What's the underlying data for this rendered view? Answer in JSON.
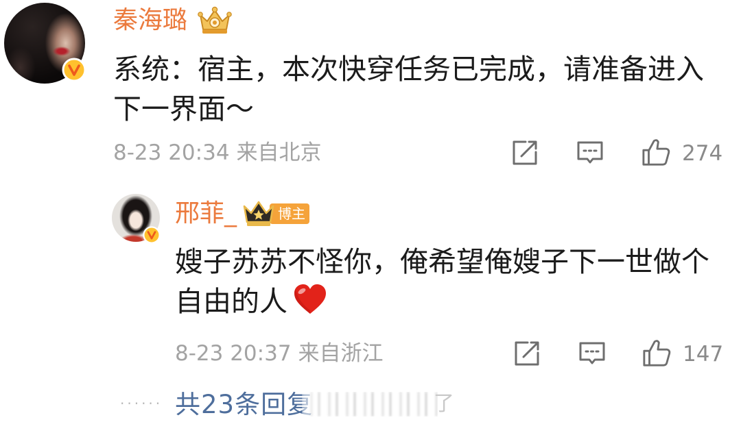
{
  "comment": {
    "username": "秦海璐",
    "verified_icon": "verified-v-icon",
    "member_icon": "gold-crown-icon",
    "lines": [
      "系统：宿主，本次快穿任务已完成，请准备进入",
      "下一界面～"
    ],
    "time": "8-23 20:34",
    "location": "来自北京",
    "likes": "274",
    "replies": [
      {
        "username": "邢菲_",
        "verified_icon": "verified-v-icon",
        "member_icon": "star-crown-icon",
        "badge": "博主",
        "lines": [
          "嫂子苏苏不怪你，俺希望俺嫂子下一世做个",
          "自由的人"
        ],
        "emoji": "red-heart-emoji",
        "time": "8-23 20:37",
        "location": "来自浙江",
        "likes": "147"
      }
    ],
    "more_replies": {
      "dots": "······",
      "label": "共23条回复"
    }
  },
  "action_icons": [
    "share-icon",
    "comment-icon",
    "thumbs-up-icon"
  ],
  "watermark": {
    "text": "了"
  },
  "colors": {
    "username": "#eb7a3d",
    "text": "#1b1b1b",
    "meta": "#a3a3a3",
    "count": "#8a8a8a",
    "icon": "#6e6e6e",
    "link": "#4e6e9c",
    "badge": "#f5a33a",
    "verified": "#ffc12e",
    "heart": "#e2231a"
  }
}
